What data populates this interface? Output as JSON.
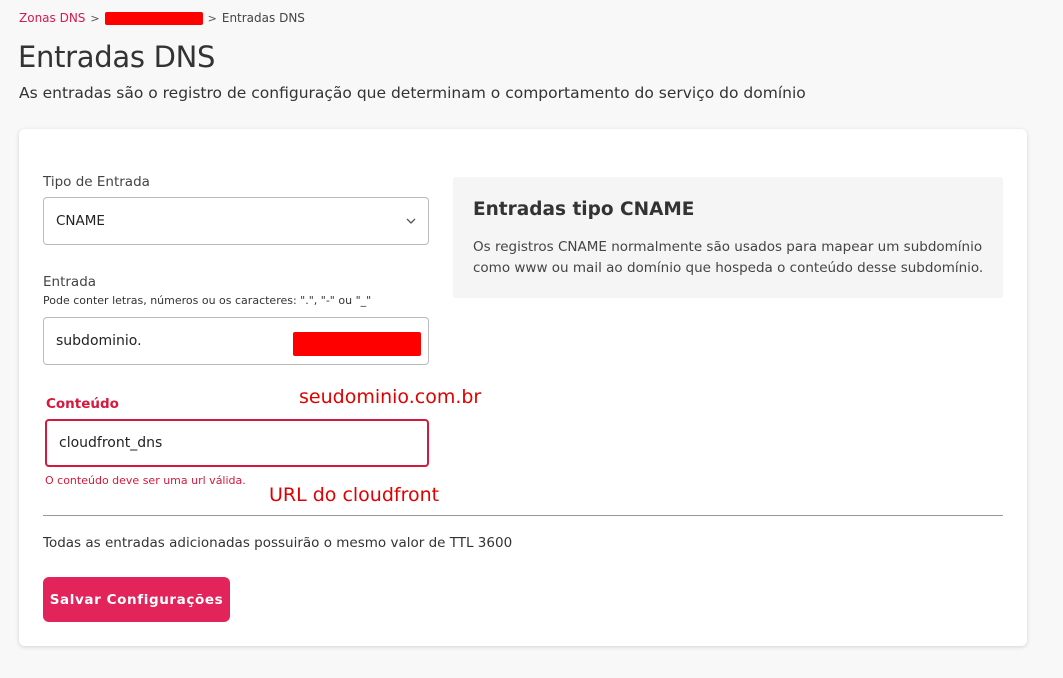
{
  "breadcrumb": {
    "root": "Zonas DNS",
    "current": "Entradas DNS"
  },
  "page": {
    "title": "Entradas DNS",
    "subtitle": "As entradas são o registro de configuração que determinam o comportamento do serviço do domínio"
  },
  "form": {
    "type": {
      "label": "Tipo de Entrada",
      "value": "CNAME"
    },
    "entry": {
      "label": "Entrada",
      "hint": "Pode conter letras, números ou os caracteres: \".\", \"-\" ou \"_\"",
      "value": "subdominio."
    },
    "content": {
      "label": "Conteúdo",
      "value": "cloudfront_dns",
      "error": "O conteúdo deve ser uma url válida."
    }
  },
  "annotations": {
    "domain": "seudominio.com.br",
    "cloudfront": "URL do cloudfront"
  },
  "info": {
    "title": "Entradas tipo CNAME",
    "text": "Os registros CNAME normalmente são usados para mapear um subdomínio como www ou mail ao domínio que hospeda o conteúdo desse subdomínio."
  },
  "ttl_note": "Todas as entradas adicionadas possuirão o mesmo valor de TTL 3600",
  "save_label": "Salvar Configurações",
  "colors": {
    "accent": "#e2245a",
    "error": "#d6183c",
    "redaction": "#ff0000",
    "annotation": "#e00000"
  }
}
